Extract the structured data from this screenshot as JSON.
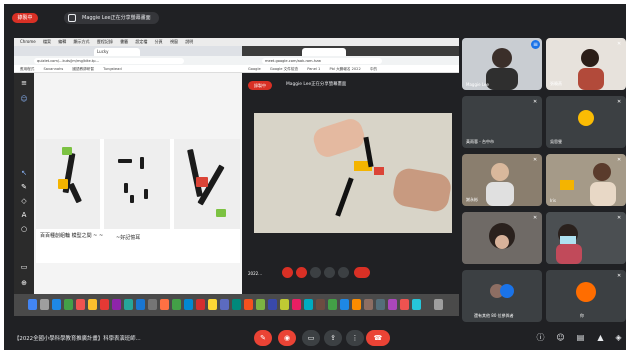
{
  "banner": {
    "rec_label": "錄製中",
    "share_label": "Maggie Lee正在分享螢幕畫面"
  },
  "mac_menu": [
    "Chrome",
    "檔案",
    "編輯",
    "顯示方式",
    "歷程記錄",
    "書籤",
    "設定檔",
    "分頁",
    "視窗",
    "說明"
  ],
  "browser_a": {
    "tab_label": "Lucky",
    "url": "quizlet.com/...kuts/jm/mg/kite.tp...",
    "bookmarks": [
      "應用程式",
      "Savannahs",
      "國語教師研習",
      "Tungstead"
    ]
  },
  "slide": {
    "caption_left": "百百種創組輪 模型之間 ~ ~",
    "caption_right": "~好記憶耳"
  },
  "browser_b": {
    "url": "meet.google.com/aak-rom-hzw",
    "bookmarks": [
      "Google",
      "Google 文件檢查",
      "Panel 1",
      "Pbl 大賽報名 2022",
      "中的"
    ],
    "inner_share_label": "Maggie Lee正在分享螢幕畫面",
    "inner_rec_label": "錄製中",
    "inner_time": "2022..."
  },
  "participants": [
    {
      "name": "Maggie Lee",
      "mic": "muted"
    },
    {
      "name": "張曉燕",
      "mic": "muted"
    },
    {
      "name": "黃雨蓉 - 台中市",
      "mic": "muted"
    },
    {
      "name": "吳思瑩",
      "mic": "muted"
    },
    {
      "name": "謝永彬",
      "mic": "muted"
    },
    {
      "name": "Iris",
      "mic": "muted"
    },
    {
      "name": "",
      "mic": "muted"
    },
    {
      "name": "",
      "mic": "muted"
    },
    {
      "name": "還有其他 80 位參與者",
      "mic": "muted"
    },
    {
      "name": "你",
      "mic": "muted"
    }
  ],
  "bottom": {
    "meeting_title": "【2022全國小學科學教育推廣計畫】科學表演班師..."
  },
  "colors": {
    "record": "#d93025",
    "end_call": "#ea4335",
    "meet_bg": "#202124",
    "tile_bg": "#3c4043"
  }
}
